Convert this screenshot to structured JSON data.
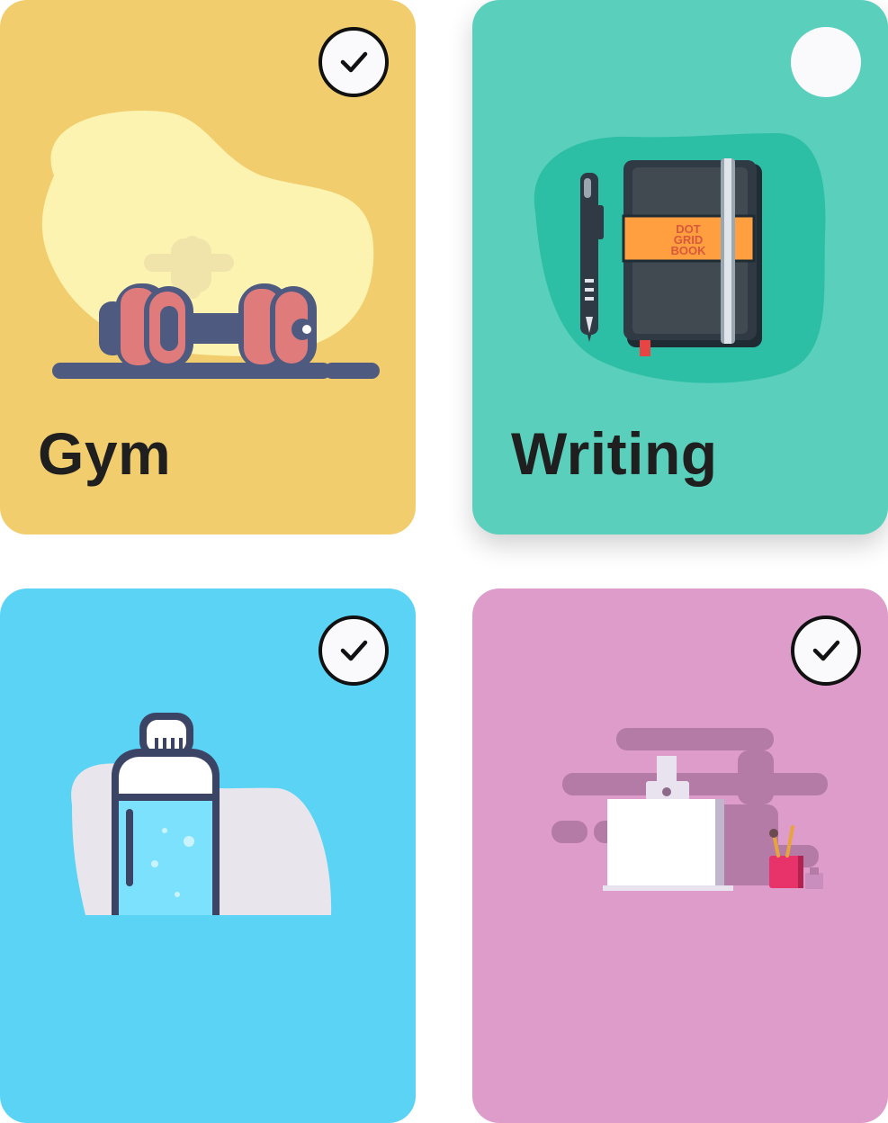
{
  "cards": [
    {
      "id": "gym",
      "title": "Gym",
      "selected": true,
      "color": "#f1cd6e"
    },
    {
      "id": "writing",
      "title": "Writing",
      "selected": false,
      "color": "#5acfbc",
      "notebook_label": [
        "DOT",
        "GRID",
        "BOOK"
      ]
    },
    {
      "id": "water",
      "title": "",
      "selected": true,
      "color": "#5bd3f5"
    },
    {
      "id": "cleaning",
      "title": "",
      "selected": true,
      "color": "#de9cca"
    }
  ]
}
